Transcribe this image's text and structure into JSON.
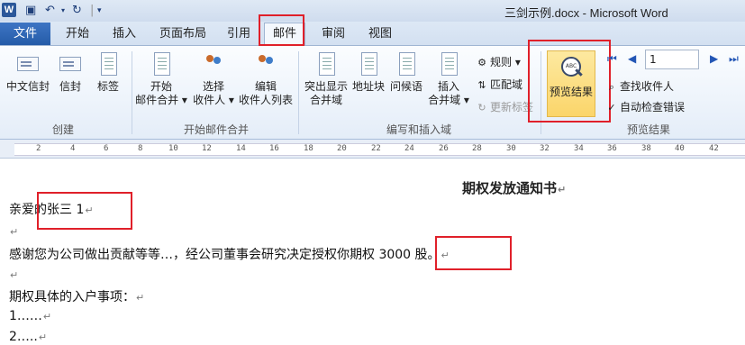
{
  "window": {
    "title": "三剑示例.docx - Microsoft Word",
    "app_icon_letter": "W"
  },
  "quick_access": {
    "save_glyph": "▣",
    "undo_glyph": "↶",
    "redo_glyph": "↻",
    "dropdown_glyph": "▾",
    "customize_glyph": "▾"
  },
  "tabs": {
    "file": "文件",
    "items": [
      "开始",
      "插入",
      "页面布局",
      "引用",
      "邮件",
      "审阅",
      "视图"
    ],
    "active": "邮件"
  },
  "ribbon": {
    "create_group": {
      "label": "创建",
      "chinese_envelope": "中文信封",
      "envelope": "信封",
      "labels": "标签"
    },
    "start_merge_group": {
      "label": "开始邮件合并",
      "start_merge_line1": "开始",
      "start_merge_line2": "邮件合并",
      "select_recipients_line1": "选择",
      "select_recipients_line2": "收件人",
      "edit_list_line1": "编辑",
      "edit_list_line2": "收件人列表"
    },
    "write_insert_group": {
      "label": "编写和插入域",
      "highlight_line1": "突出显示",
      "highlight_line2": "合并域",
      "address_block": "地址块",
      "greeting_line": "问候语",
      "insert_field_line1": "插入",
      "insert_field_line2": "合并域",
      "rules": "规则",
      "match_fields": "匹配域",
      "update_labels": "更新标签"
    },
    "preview_group": {
      "label": "预览结果",
      "preview_results": "预览结果",
      "record_number": "1",
      "find_recipient": "查找收件人",
      "auto_check": "自动检查错误"
    }
  },
  "ruler": {
    "numbers": [
      "2",
      "4",
      "6",
      "8",
      "10",
      "12",
      "14",
      "16",
      "18",
      "20",
      "22",
      "24",
      "26",
      "28",
      "30",
      "32",
      "34",
      "36",
      "38",
      "40",
      "42"
    ]
  },
  "document": {
    "title": "期权发放通知书",
    "salutation_prefix": "亲爱的",
    "salutation_name": "张三 1",
    "body_prefix": "感谢您为公司做出贡献等等…，经公司董事会研究决定授权你期",
    "body_quantity": "权 3000 股。",
    "details_heading": "期权具体的入户事项：",
    "item1": "1……",
    "item2": "2…..",
    "paragraph_mark": "↵"
  }
}
